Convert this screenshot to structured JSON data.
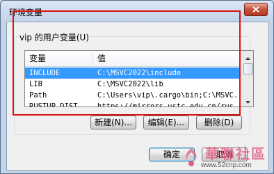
{
  "window": {
    "title": "环境变量",
    "close_icon": "close-icon"
  },
  "user_vars": {
    "group_label": "vip 的用户变量(U)",
    "columns": [
      "变量",
      "值"
    ],
    "rows": [
      {
        "name": "INCLUDE",
        "value": "C:\\MSVC2022\\include",
        "selected": true
      },
      {
        "name": "LIB",
        "value": "C:\\MSVC2022\\lib",
        "selected": false
      },
      {
        "name": "Path",
        "value": "C:\\Users\\vip\\.cargo\\bin;C:\\MSVC...",
        "selected": false
      },
      {
        "name": "RUSTUP_DIST_...",
        "value": "https://mirrors.ustc.edu.cn/rus...",
        "selected": false
      }
    ]
  },
  "buttons": {
    "new": "新建(N)...",
    "edit": "编辑(E)...",
    "delete": "删除(D)",
    "ok": "确定",
    "cancel": "取消"
  },
  "watermark": {
    "title": "華聯社區",
    "url": "www.52cnp.com"
  },
  "colors": {
    "selection": "#3399ff",
    "highlight_box": "#e01010",
    "close_button": "#c7503c"
  }
}
